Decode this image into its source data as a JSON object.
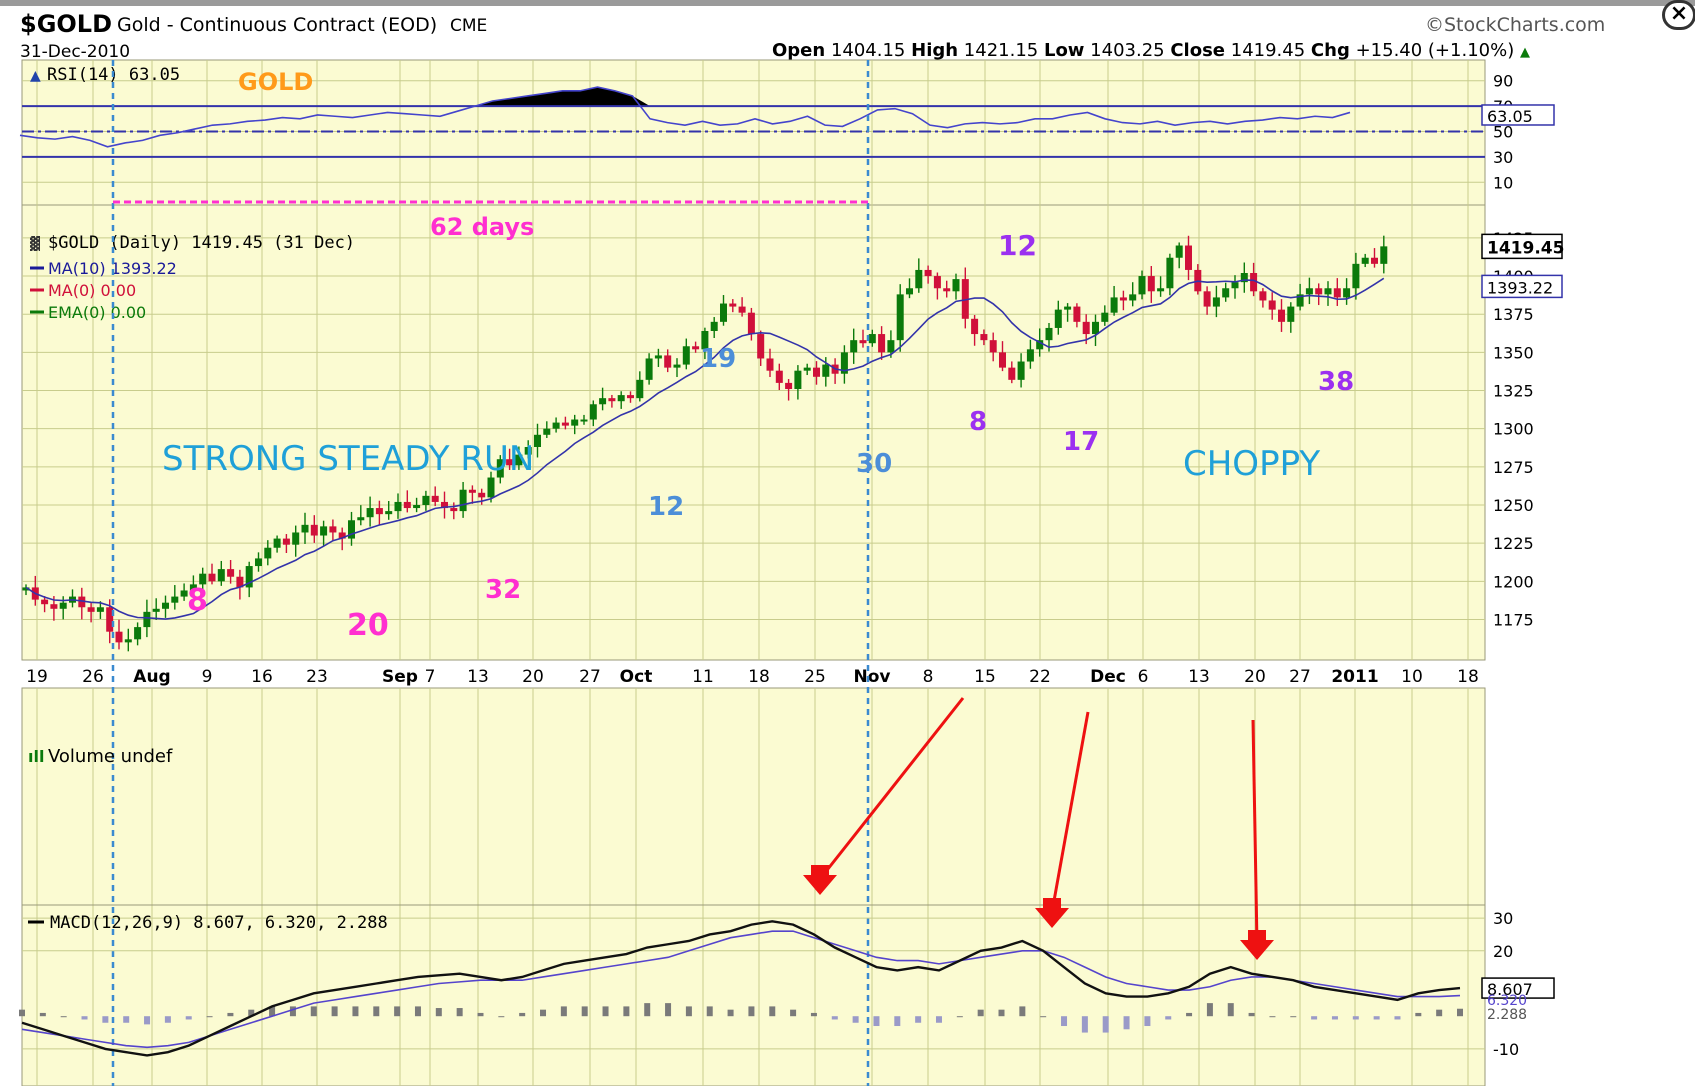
{
  "header": {
    "ticker": "$GOLD",
    "name": "Gold - Continuous Contract (EOD)",
    "exchange": "CME",
    "date": "31-Dec-2010",
    "brand": "©StockCharts.com",
    "ohlc": {
      "open_label": "Open",
      "open": "1404.15",
      "high_label": "High",
      "high": "1421.15",
      "low_label": "Low",
      "low": "1403.25",
      "close_label": "Close",
      "close": "1419.45",
      "chg_label": "Chg",
      "chg": "+15.40 (+1.10%)"
    }
  },
  "close_icon": "close-icon",
  "colors": {
    "panel_bg": "#fbfbd2",
    "grid": "#c8cc8c",
    "up_candle": "#0b7a0b",
    "down_candle": "#d0103a",
    "ma_line": "#3333aa",
    "annot_blue": "#1fa0d8",
    "annot_magenta": "#ff2fd0",
    "annot_purple": "#9b30f0",
    "annot_orange": "#ff9a1a",
    "arrow_red": "#ee1111"
  },
  "chart_data": [
    {
      "type": "line",
      "name": "RSI panel",
      "label": "RSI(14) 63.05",
      "overlay_label": "GOLD",
      "last_value_tag": "63.05",
      "y_ticks": [
        "90",
        "70",
        "50",
        "30",
        "10"
      ],
      "ylim": [
        0,
        100
      ],
      "levels": [
        70,
        50,
        30
      ],
      "x": [
        0,
        2,
        4,
        6,
        8,
        10,
        12,
        14,
        16,
        18,
        20,
        22,
        24,
        26,
        28,
        30,
        32,
        34,
        36,
        38,
        40,
        42,
        44,
        46,
        48,
        50,
        52,
        54,
        56,
        58,
        60,
        62,
        64,
        66,
        68,
        70,
        72,
        74,
        76,
        78,
        80,
        82,
        84,
        86,
        88,
        90,
        92,
        94,
        96,
        98,
        100,
        102,
        104,
        106,
        108,
        110,
        112,
        114,
        116,
        118,
        120,
        122,
        124
      ],
      "values": [
        47,
        45,
        44,
        46,
        43,
        38,
        41,
        43,
        47,
        49,
        52,
        55,
        56,
        58,
        59,
        61,
        60,
        63,
        62,
        61,
        63,
        65,
        64,
        63,
        62,
        66,
        70,
        74,
        76,
        78,
        80,
        82,
        82,
        85,
        82,
        78,
        60,
        57,
        55,
        58,
        55,
        56,
        60,
        56,
        58,
        62,
        55,
        54,
        60,
        67,
        68,
        64,
        55,
        53,
        56,
        57,
        56,
        57,
        60,
        60,
        63,
        65,
        60,
        57,
        56,
        58,
        55,
        57,
        58,
        56,
        58,
        59,
        61,
        60,
        62,
        61,
        65
      ]
    },
    {
      "type": "candlestick",
      "name": "price panel",
      "label": "$GOLD (Daily) 1419.45 (31 Dec)",
      "legend": [
        {
          "text": "MA(10) 1393.22",
          "color": "#1a1a99"
        },
        {
          "text": "MA(0) 0.00",
          "color": "#d0103a"
        },
        {
          "text": "EMA(0) 0.00",
          "color": "#0b7a0b"
        }
      ],
      "last_close_tag": "1419.45",
      "ma_tag": "1393.22",
      "y_ticks": [
        "1425",
        "1400",
        "1375",
        "1350",
        "1325",
        "1300",
        "1275",
        "1250",
        "1225",
        "1200",
        "1175"
      ],
      "ylim": [
        1155,
        1440
      ],
      "x_ticks": [
        "19",
        "26",
        "Aug",
        "9",
        "16",
        "23",
        "Sep",
        "7",
        "13",
        "20",
        "27",
        "Oct",
        "11",
        "18",
        "25",
        "Nov",
        "8",
        "15",
        "22",
        "Dec",
        "6",
        "13",
        "20",
        "27",
        "2011",
        "10",
        "18"
      ],
      "close": [
        1196,
        1188,
        1185,
        1182,
        1186,
        1190,
        1183,
        1180,
        1183,
        1167,
        1160,
        1162,
        1170,
        1180,
        1182,
        1186,
        1190,
        1194,
        1198,
        1205,
        1200,
        1208,
        1203,
        1196,
        1210,
        1215,
        1222,
        1228,
        1224,
        1232,
        1237,
        1230,
        1236,
        1232,
        1228,
        1240,
        1242,
        1248,
        1244,
        1246,
        1252,
        1248,
        1250,
        1256,
        1252,
        1248,
        1246,
        1260,
        1258,
        1255,
        1268,
        1280,
        1276,
        1283,
        1288,
        1296,
        1300,
        1304,
        1302,
        1306,
        1306,
        1316,
        1320,
        1318,
        1322,
        1320,
        1332,
        1346,
        1348,
        1340,
        1342,
        1354,
        1352,
        1364,
        1370,
        1382,
        1380,
        1376,
        1362,
        1346,
        1338,
        1330,
        1326,
        1338,
        1340,
        1334,
        1342,
        1336,
        1350,
        1358,
        1356,
        1362,
        1350,
        1358,
        1388,
        1392,
        1404,
        1400,
        1392,
        1390,
        1398,
        1372,
        1362,
        1358,
        1350,
        1340,
        1332,
        1344,
        1352,
        1358,
        1366,
        1378,
        1380,
        1370,
        1362,
        1370,
        1376,
        1386,
        1384,
        1388,
        1400,
        1390,
        1392,
        1412,
        1420,
        1404,
        1390,
        1380,
        1386,
        1392,
        1396,
        1402,
        1390,
        1384,
        1378,
        1370,
        1380,
        1388,
        1392,
        1388,
        1392,
        1386,
        1392,
        1408,
        1412,
        1408,
        1419.45
      ]
    },
    {
      "type": "line",
      "name": "MACD panel",
      "label": "MACD(12,26,9) 8.607, 6.320, 2.288",
      "volume_label": "Volume undef",
      "macd_tag": "8.607",
      "signal_tag": "6.320",
      "hist_tag": "2.288",
      "y_ticks": [
        "30",
        "20",
        "-10"
      ],
      "ylim": [
        -14,
        34
      ],
      "macd": [
        -2,
        -4,
        -6,
        -8,
        -10,
        -11,
        -12,
        -11,
        -9,
        -6,
        -3,
        0,
        3,
        5,
        7,
        8,
        9,
        10,
        11,
        12,
        12.5,
        13,
        12,
        11,
        12,
        14,
        16,
        17,
        18,
        19,
        21,
        22,
        23,
        25,
        26,
        28,
        29,
        28,
        25,
        21,
        18,
        15,
        14,
        15,
        14,
        17,
        20,
        21,
        23,
        20,
        15,
        10,
        7,
        6,
        6,
        7,
        9,
        13,
        15,
        13,
        12,
        11,
        9,
        8,
        7,
        6,
        5,
        7,
        8,
        8.607
      ],
      "signal": [
        -4,
        -5,
        -6,
        -7,
        -8,
        -9,
        -9.5,
        -9,
        -8,
        -6,
        -4,
        -2,
        0,
        2,
        4,
        5,
        6,
        7,
        8,
        9,
        10,
        10.5,
        11,
        11,
        11,
        12,
        13,
        14,
        15,
        16,
        17,
        18,
        20,
        22,
        24,
        25,
        26,
        26,
        24,
        22,
        20,
        18,
        17,
        17,
        16,
        17,
        18,
        19,
        20,
        20,
        18,
        15,
        12,
        10,
        9,
        8,
        8,
        9,
        11,
        12,
        12,
        11,
        10,
        9,
        8,
        7,
        6,
        6,
        6,
        6.32
      ]
    }
  ],
  "annotations": {
    "days_label": "62 days",
    "strong": "STRONG STEADY RUN",
    "choppy": "CHOPPY",
    "n8a": "8",
    "n20": "20",
    "n32": "32",
    "n19": "19",
    "n12a": "12",
    "n30": "30",
    "n8b": "8",
    "n12b": "12",
    "n17": "17",
    "n38": "38"
  }
}
